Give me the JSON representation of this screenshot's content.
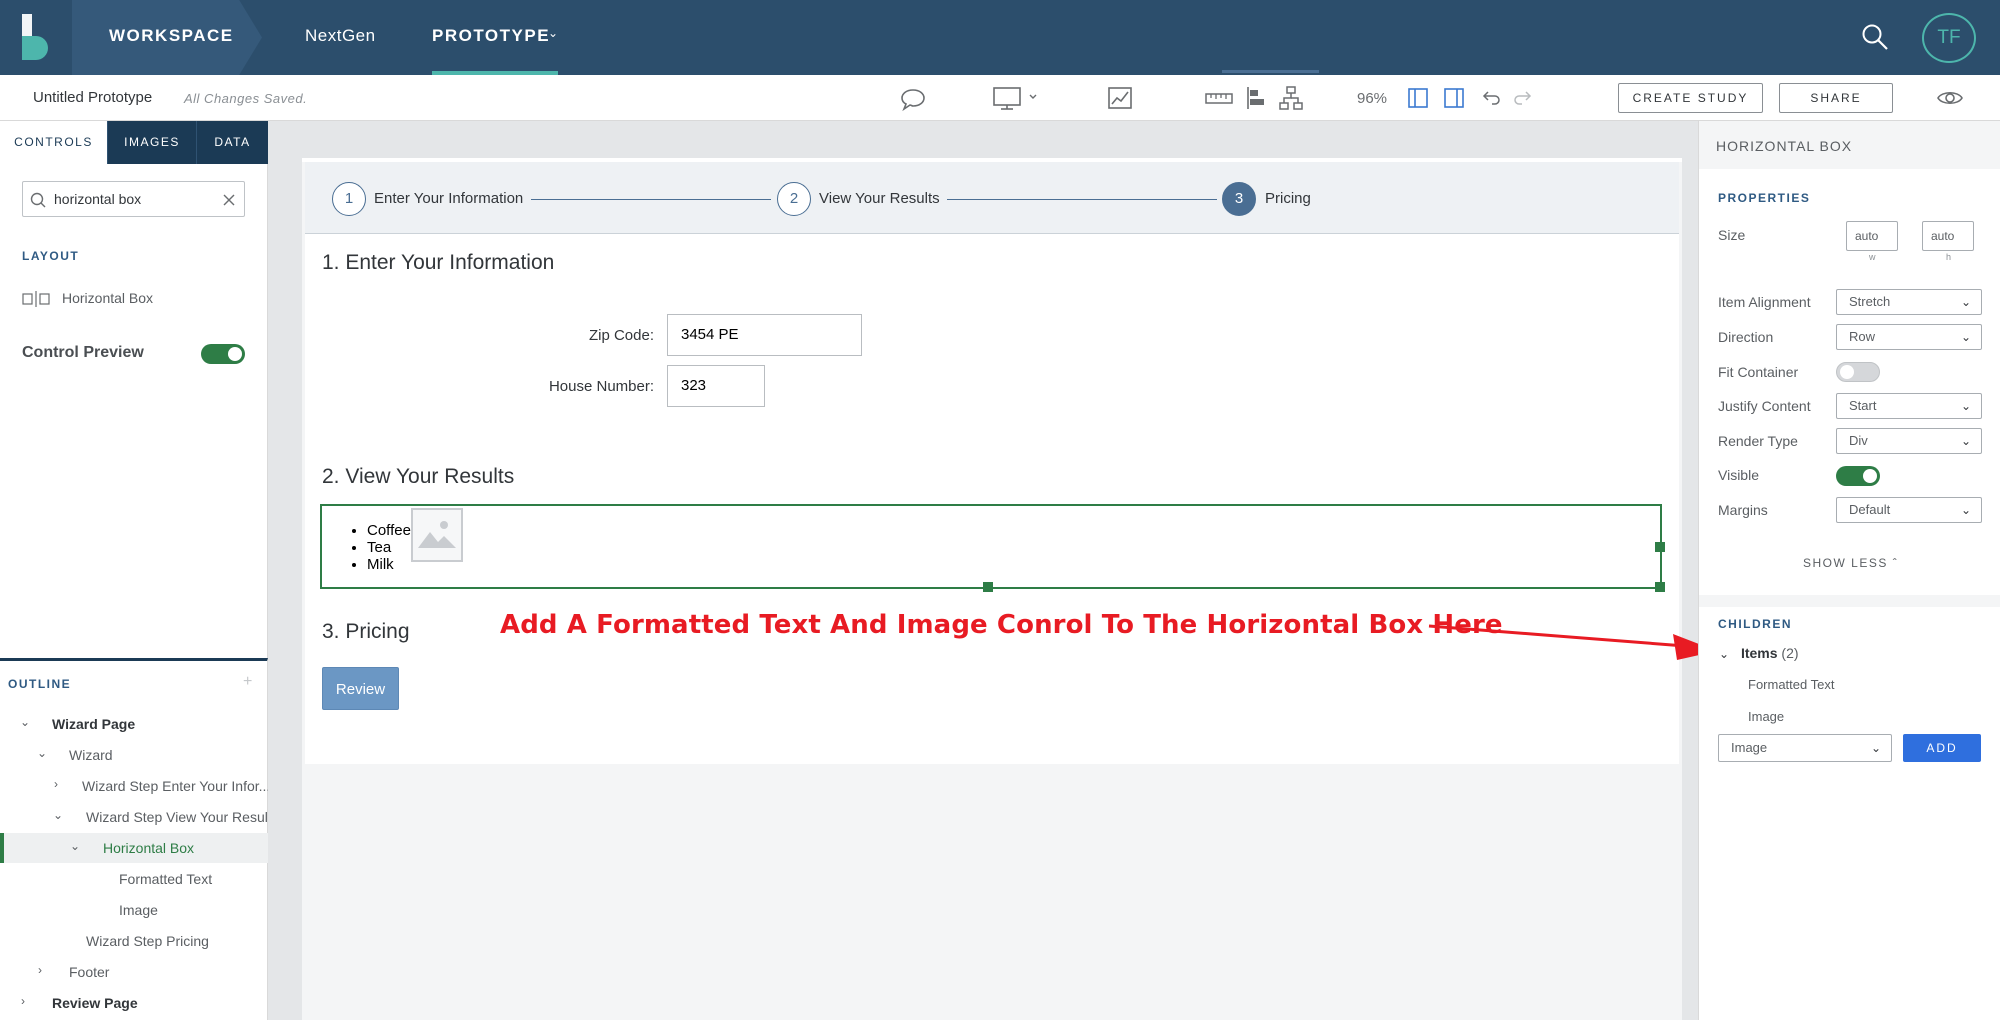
{
  "topbar": {
    "workspace_label": "WORKSPACE",
    "nextgen_label": "NextGen",
    "prototype_label": "PROTOTYPE",
    "avatar_initials": "TF",
    "accent_color": "#4db6ac"
  },
  "toolbar": {
    "title": "Untitled Prototype",
    "saved_status": "All Changes Saved.",
    "zoom": "96%",
    "create_study_label": "CREATE STUDY",
    "share_label": "SHARE",
    "icons": [
      "comment-icon",
      "desktop-device-icon",
      "annotate-icon",
      "ruler-icon",
      "align-icon",
      "hierarchy-icon",
      "left-panel-icon",
      "right-panel-icon",
      "undo-icon",
      "redo-icon",
      "preview-eye-icon"
    ]
  },
  "left_panel": {
    "tabs": [
      "CONTROLS",
      "IMAGES",
      "DATA"
    ],
    "search_value": "horizontal box",
    "section_label": "LAYOUT",
    "control_item": "Horizontal Box",
    "preview_label": "Control Preview"
  },
  "outline": {
    "title": "OUTLINE",
    "rows": [
      {
        "label": "Wizard Page"
      },
      {
        "label": "Wizard"
      },
      {
        "label": "Wizard Step Enter Your Infor..."
      },
      {
        "label": "Wizard Step View Your Results"
      },
      {
        "label": "Horizontal Box"
      },
      {
        "label": "Formatted Text"
      },
      {
        "label": "Image"
      },
      {
        "label": "Wizard Step Pricing"
      },
      {
        "label": "Footer"
      },
      {
        "label": "Review Page"
      }
    ]
  },
  "wizard": {
    "steps": [
      {
        "number": "1",
        "label": "Enter Your Information"
      },
      {
        "number": "2",
        "label": "View Your Results"
      },
      {
        "number": "3",
        "label": "Pricing"
      }
    ],
    "section1_title": "1. Enter Your Information",
    "zip_label": "Zip Code:",
    "zip_value": "3454 PE",
    "house_label": "House Number:",
    "house_value": "323",
    "section2_title": "2. View Your Results",
    "list_items": [
      "Coffee",
      "Tea",
      "Milk"
    ],
    "section3_title": "3. Pricing",
    "review_label": "Review"
  },
  "annotation": {
    "text": "Add A Formatted Text And Image Conrol To The Horizontal Box Here",
    "color": "#e81b23"
  },
  "right_panel": {
    "title": "HORIZONTAL BOX",
    "properties_label": "PROPERTIES",
    "size_label": "Size",
    "size_w": "auto",
    "size_h": "auto",
    "size_w_sub": "w",
    "size_h_sub": "h",
    "item_alignment_label": "Item Alignment",
    "item_alignment_value": "Stretch",
    "direction_label": "Direction",
    "direction_value": "Row",
    "fit_container_label": "Fit Container",
    "justify_label": "Justify Content",
    "justify_value": "Start",
    "render_label": "Render Type",
    "render_value": "Div",
    "visible_label": "Visible",
    "margins_label": "Margins",
    "margins_value": "Default",
    "show_less_label": "SHOW LESS",
    "children_label": "CHILDREN",
    "items_label": "Items",
    "items_count": "(2)",
    "children": [
      "Formatted Text",
      "Image"
    ],
    "add_select_value": "Image",
    "add_label": "ADD"
  }
}
